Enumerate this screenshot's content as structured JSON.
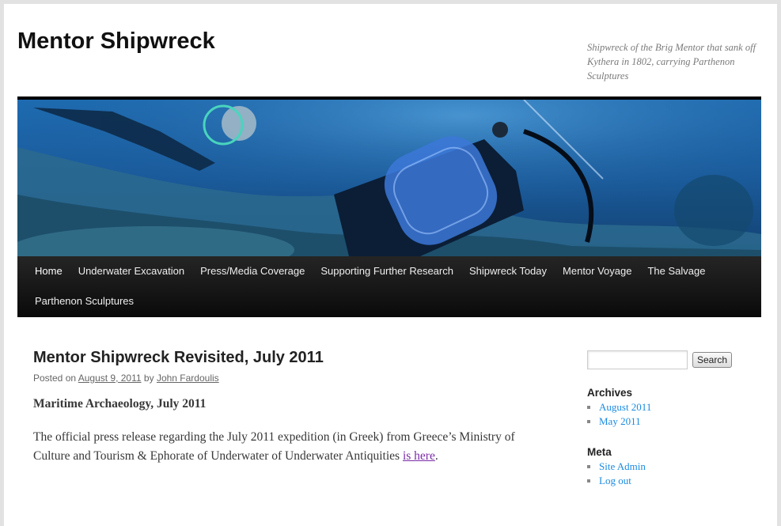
{
  "site": {
    "title": "Mentor Shipwreck",
    "description": "Shipwreck of the Brig Mentor that sank off Kythera in 1802, carrying Parthenon Sculptures"
  },
  "nav": {
    "items": [
      {
        "label": "Home"
      },
      {
        "label": "Underwater Excavation"
      },
      {
        "label": "Press/Media Coverage"
      },
      {
        "label": "Supporting Further Research"
      },
      {
        "label": "Shipwreck Today"
      },
      {
        "label": "Mentor Voyage"
      },
      {
        "label": "The Salvage"
      },
      {
        "label": "Parthenon Sculptures"
      }
    ]
  },
  "post": {
    "title": "Mentor Shipwreck Revisited, July 2011",
    "posted_on": "Posted on",
    "date": "August 9, 2011",
    "by": "by",
    "author": "John Fardoulis",
    "heading": "Maritime Archaeology, July 2011",
    "paragraph": "The official press release regarding the July 2011 expedition (in Greek) from Greece’s Ministry of Culture and Tourism & Ephorate of Underwater of Underwater Antiquities",
    "link_text": "is here",
    "trail": "."
  },
  "sidebar": {
    "search_placeholder": "",
    "search_button": "Search",
    "archives_title": "Archives",
    "archives": [
      "August 2011",
      "May 2011"
    ],
    "meta_title": "Meta",
    "meta": [
      "Site Admin",
      "Log out"
    ]
  },
  "colors": {
    "nav_bg": "#000000",
    "link": "#1b8be0",
    "visited_link": "#7a2ba7"
  }
}
